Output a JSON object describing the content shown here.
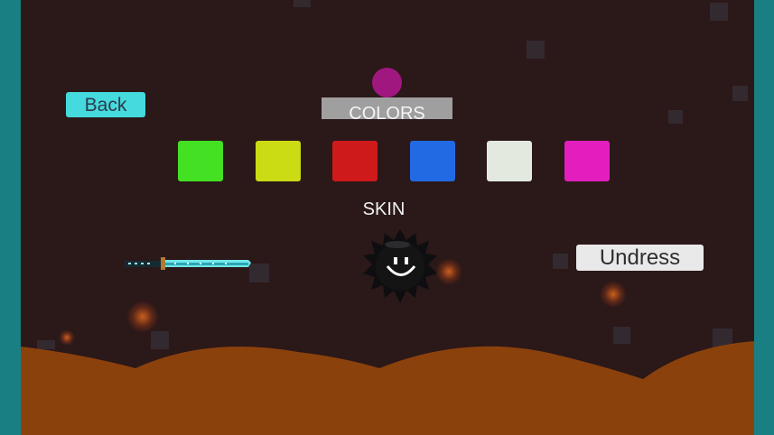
{
  "game": {
    "buttons": {
      "back_label": "Back",
      "undress_label": "Undress"
    },
    "sections": {
      "colors_title": "COLORS",
      "skin_title": "SKIN"
    },
    "selected_color": "#a0187f",
    "color_swatches": [
      {
        "name": "green",
        "hex": "#44e024"
      },
      {
        "name": "yellow",
        "hex": "#cbdb14"
      },
      {
        "name": "red",
        "hex": "#cf1a1c"
      },
      {
        "name": "blue",
        "hex": "#226ae3"
      },
      {
        "name": "white",
        "hex": "#e3e9df"
      },
      {
        "name": "magenta",
        "hex": "#e21fbe"
      }
    ],
    "skin_items": [
      {
        "name": "katana",
        "icon": "katana-icon"
      }
    ],
    "player_icon": "spiky-smiley-ball-icon",
    "palette": {
      "background": "#2b1819",
      "walls": "#197f82",
      "ground": "#8b410c",
      "accent": "#45dadd"
    }
  }
}
